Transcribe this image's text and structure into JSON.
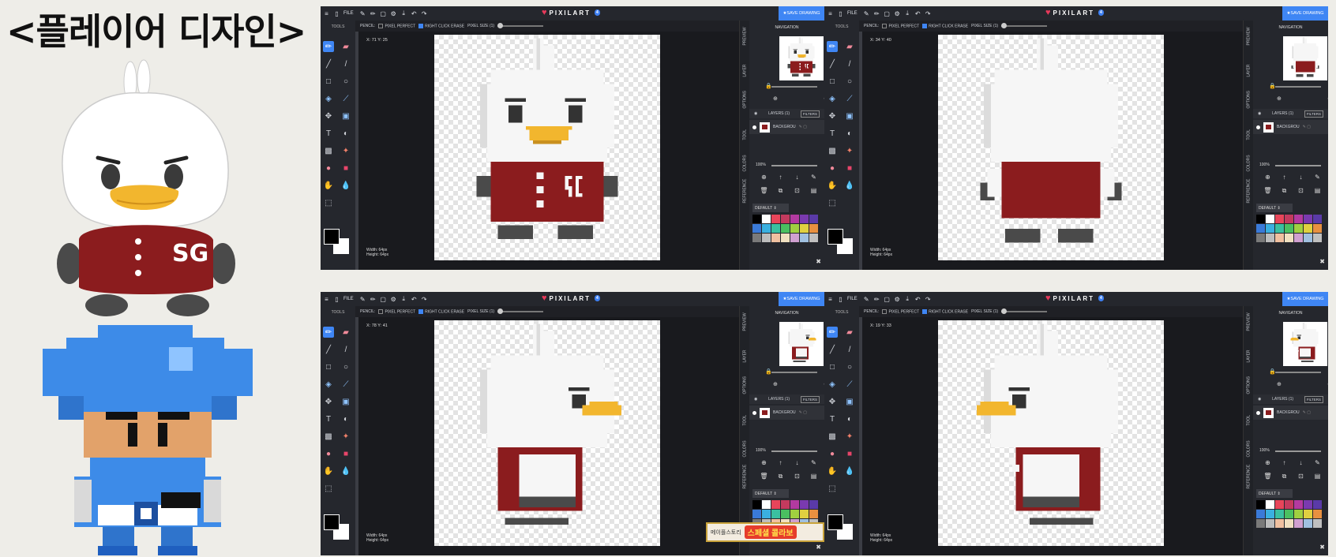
{
  "title": "<플레이어 디자인>",
  "colors": {
    "accent": "#3f86f4",
    "body_red": "#8b1c1e",
    "beak": "#f2b62e",
    "blue": "#3d8be8"
  },
  "editor": {
    "brand": "PIXILART",
    "notifications": "4",
    "file_menu": "FILE",
    "save_button": "SAVE DRAWING",
    "tools_label": "TOOLS",
    "pencil_label": "PENCIL:",
    "pixel_perfect": "PIXEL PERFECT",
    "right_click_erase": "RIGHT CLICK ERASE",
    "pixel_size": "PIXEL SIZE (1)",
    "navigation_label": "NAVIGATION",
    "layers_label": "LAYERS (1)",
    "filters_label": "FILTERS",
    "layer_name": "BACKGROU",
    "opacity": "100%",
    "palette_name": "DEFAULT",
    "width_text": "Width: 64px",
    "height_text": "Height: 64px",
    "side_tabs": [
      "PREVIEW",
      "LAYER",
      "OPTIONS",
      "TOOL",
      "COLORS",
      "REFERENCE"
    ],
    "palette": [
      "#000000",
      "#ffffff",
      "#e8455a",
      "#c43a5e",
      "#b33aa0",
      "#7a3ab0",
      "#5a3aa8",
      "#3a7ad8",
      "#3ab0e0",
      "#3ac0a0",
      "#4ac060",
      "#a0d040",
      "#e0d040",
      "#e89040",
      "#7a7a7a",
      "#bdbdbd",
      "#f0c0a0",
      "#f0e0c0",
      "#d0a0d0",
      "#a0c0e0",
      "#c0c0c0"
    ]
  },
  "panels": [
    {
      "coords": "X: 71 Y: 25",
      "view": "front"
    },
    {
      "coords": "X: 34 Y: 40",
      "view": "back"
    },
    {
      "coords": "X: 78 Y: 41",
      "view": "right"
    },
    {
      "coords": "X: 19 Y: 33",
      "view": "left"
    }
  ],
  "mascot": {
    "logo": "SG"
  },
  "ad_text": {
    "left": "메이플스토리",
    "right": "스페셜 콜라보"
  }
}
